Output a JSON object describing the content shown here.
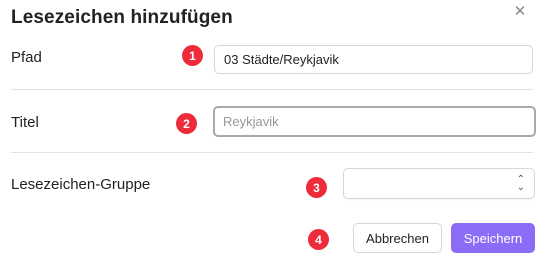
{
  "dialog": {
    "title": "Lesezeichen hinzufügen",
    "close_icon": "close-icon"
  },
  "fields": {
    "path": {
      "label": "Pfad",
      "value": "03 Städte/Reykjavik",
      "badge": "1"
    },
    "title": {
      "label": "Titel",
      "value": "",
      "placeholder": "Reykjavik",
      "badge": "2"
    },
    "group": {
      "label": "Lesezeichen-Gruppe",
      "value": "",
      "badge": "3"
    }
  },
  "actions": {
    "badge": "4",
    "cancel_label": "Abbrechen",
    "save_label": "Speichern"
  },
  "colors": {
    "accent": "#8b6cf6",
    "badge": "#ee2b3b"
  }
}
